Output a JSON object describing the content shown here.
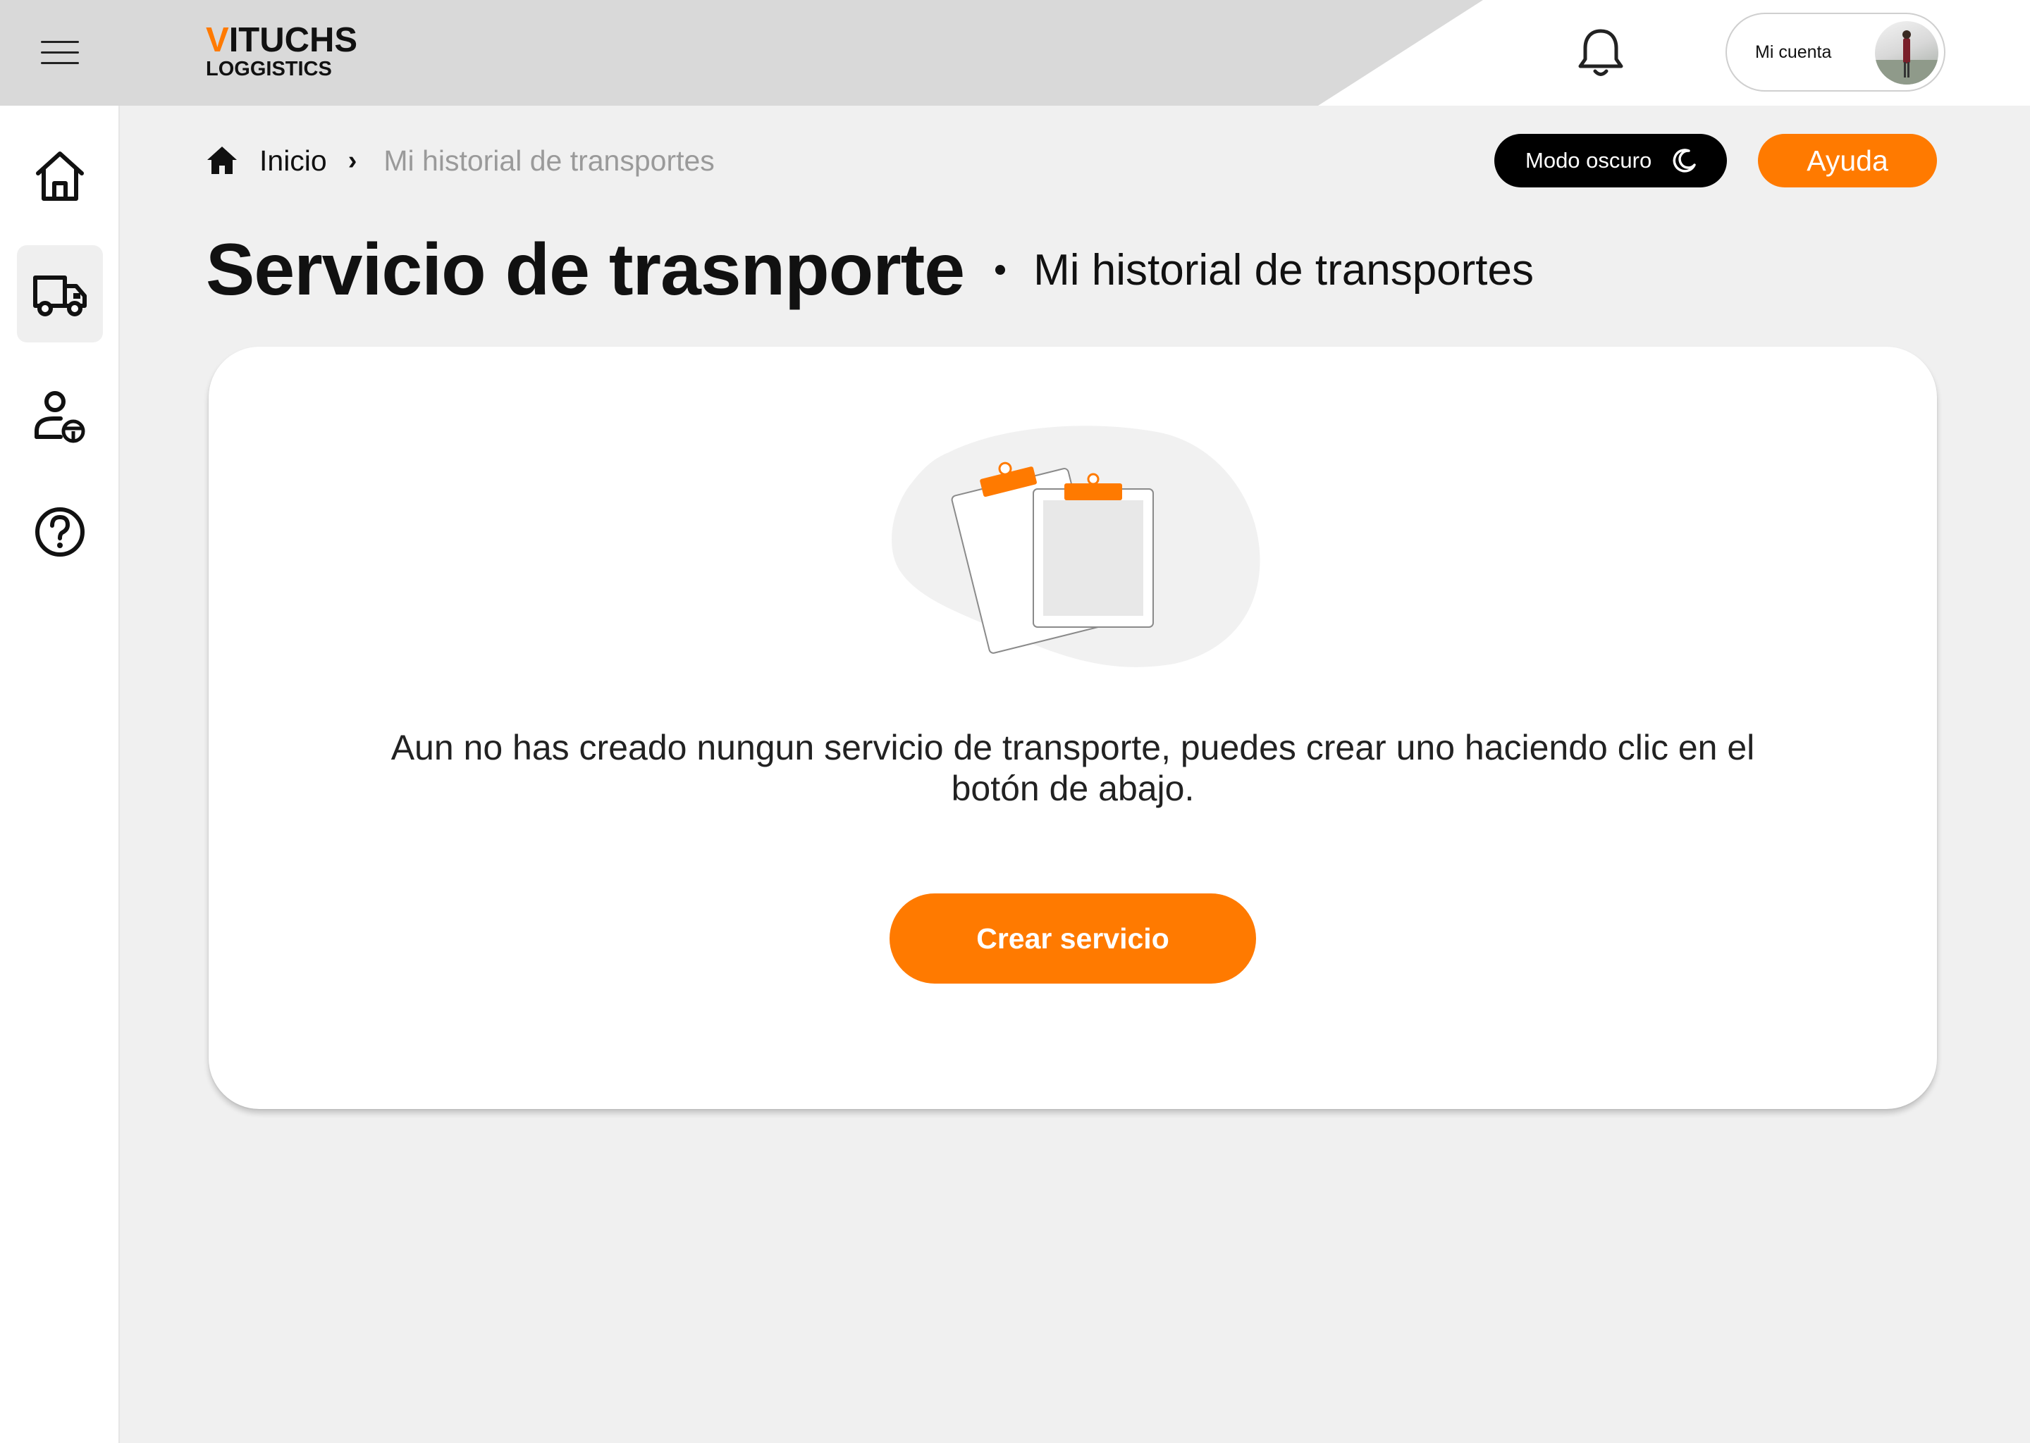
{
  "header": {
    "brand_main_accent": "V",
    "brand_main_rest": "ITUCHS",
    "brand_sub": "LOGGISTICS",
    "account_label": "Mi cuenta"
  },
  "sidebar": {
    "items": [
      {
        "name": "home-icon"
      },
      {
        "name": "truck-icon",
        "active": true
      },
      {
        "name": "driver-icon"
      },
      {
        "name": "help-circle-icon"
      }
    ]
  },
  "breadcrumb": {
    "home": "Inicio",
    "separator": "›",
    "current": "Mi historial de transportes"
  },
  "actions": {
    "dark_mode_label": "Modo oscuro",
    "help_label": "Ayuda"
  },
  "page": {
    "title": "Servicio de trasnporte",
    "subtitle": "Mi historial de transportes"
  },
  "empty_state": {
    "message": "Aun no has creado nungun servicio de transporte, puedes crear uno haciendo clic en el botón de abajo.",
    "button_label": "Crear servicio"
  },
  "colors": {
    "accent": "#ff7a00",
    "background": "#f0f0f0",
    "header_grey": "#d9d9d9"
  }
}
